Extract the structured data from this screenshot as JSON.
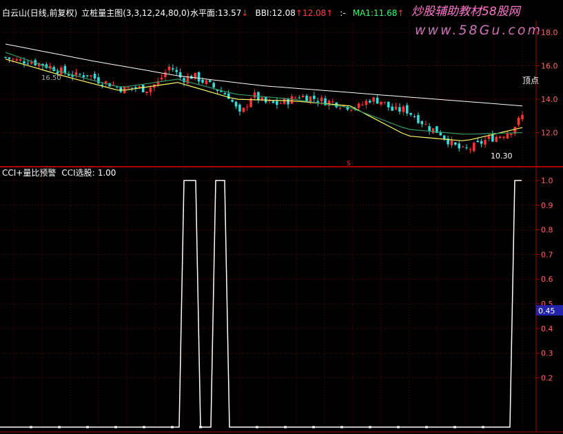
{
  "header": {
    "stock_name": "白云山",
    "stock_suffix": "(日线,前复权)",
    "indicator_name": "立桩量主图(3,3,12,24,80,0)",
    "items": [
      {
        "label": "水平面:",
        "value": "13.57",
        "arrow": "↓",
        "label_color": "#ffffff",
        "value_color": "#ffffff"
      },
      {
        "label": "BBI:",
        "value": "12.08",
        "arrow": "↑",
        "label_color": "#ffffff",
        "value_color": "#ffffff"
      },
      {
        "label": "",
        "value": "12.08",
        "arrow": "↑",
        "label_color": "#ff4444",
        "value_color": "#ff4444"
      },
      {
        "label": ":-",
        "value": "",
        "arrow": "",
        "label_color": "#ffffff",
        "value_color": "#ffffff"
      },
      {
        "label": "MA1:",
        "value": "11.68",
        "arrow": "↑",
        "label_color": "#33ff66",
        "value_color": "#33ff66"
      }
    ]
  },
  "watermark": {
    "brand_cn": "炒股辅助教材",
    "brand_num": "58股网",
    "url": "www.58Gu.com"
  },
  "upper_panel": {
    "annotation_top": "顶点",
    "annotation_low": "10.30",
    "annotation_high": "16.50",
    "marker_s": "S"
  },
  "lower_panel": {
    "title": "CCI+量比预警",
    "value_label": "CCI选股:",
    "value": "1.00",
    "current_marker": "0.45"
  },
  "colors": {
    "background": "#000000",
    "panel_border": "#aa0000",
    "grid": "#7a0000",
    "axis_text": "#ff6666",
    "up": "#ff3333",
    "down": "#33dddd",
    "ma_yellow": "#ffff66",
    "ma_green": "#339966",
    "line_white": "#ffffff",
    "marker_blue": "#2222aa"
  },
  "chart_data": [
    {
      "type": "candlestick",
      "ylim": [
        10,
        18.7
      ],
      "yticks": [
        "18.0",
        "16.0",
        "14.0",
        "12.0"
      ],
      "candles": {
        "count": 140,
        "close_path": [
          16.5,
          16.3,
          16.3,
          16.1,
          15.9,
          15.6,
          15.4,
          15.5,
          15.1,
          14.9,
          14.6,
          14.7,
          14.6,
          15.0,
          16.0,
          15.2,
          15.4,
          15.0,
          14.6,
          14.2,
          13.0,
          14.3,
          13.8,
          13.7,
          13.9,
          14.2,
          14.1,
          13.9,
          13.8,
          13.6,
          13.5,
          14.0,
          13.9,
          13.3,
          13.4,
          12.9,
          12.3,
          12.0,
          11.3,
          10.9,
          11.2,
          11.6,
          11.8,
          12.1,
          13.0
        ],
        "close_path_count": 45
      },
      "overlay_lines": [
        {
          "key": "upper_white",
          "points": [
            17.3,
            16.3,
            15.4,
            14.8,
            14.4,
            14.0,
            13.6
          ]
        },
        {
          "key": "ma_yellow",
          "points": [
            16.4,
            15.4,
            14.5,
            15.0,
            14.0,
            13.9,
            13.6,
            11.8,
            11.5,
            12.3
          ]
        },
        {
          "key": "ma_green",
          "points": [
            16.8,
            15.6,
            14.7,
            15.2,
            14.3,
            14.0,
            13.5,
            12.2,
            11.9,
            12.0
          ]
        }
      ]
    },
    {
      "type": "line",
      "title": "CCI+量比预警",
      "ylim": [
        0,
        1.05
      ],
      "yticks": [
        "1.0",
        "0.9",
        "0.8",
        "0.7",
        "0.6",
        "0.5",
        "0.4",
        "0.3",
        "0.2"
      ],
      "series": [
        {
          "name": "CCI选股",
          "x": [
            0,
            260,
            267,
            284,
            291,
            306,
            313,
            326,
            333,
            740,
            747,
            757
          ],
          "values": [
            0,
            0,
            1,
            1,
            0,
            0,
            1,
            1,
            0,
            0,
            1,
            1
          ]
        }
      ]
    }
  ]
}
